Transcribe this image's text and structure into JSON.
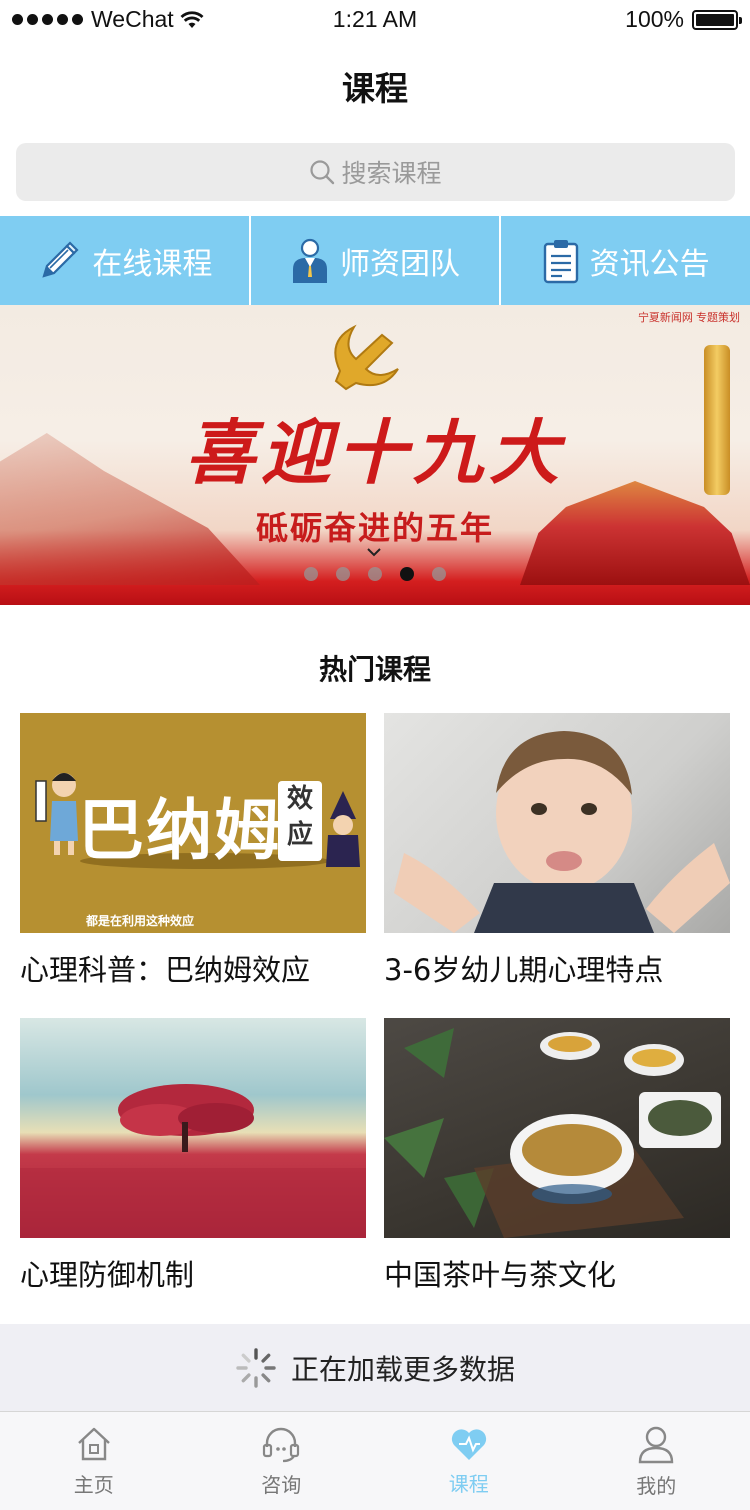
{
  "status_bar": {
    "carrier": "WeChat",
    "time": "1:21 AM",
    "battery": "100%"
  },
  "page_title": "课程",
  "search": {
    "placeholder": "搜索课程"
  },
  "categories": [
    {
      "label": "在线课程",
      "icon": "pencil-icon"
    },
    {
      "label": "师资团队",
      "icon": "teacher-icon"
    },
    {
      "label": "资讯公告",
      "icon": "clipboard-icon"
    }
  ],
  "banner": {
    "headline": "喜迎十九大",
    "subline": "砥砺奋进的五年",
    "corner_tag": "宁夏新闻网 专题策划",
    "slide_count": 5,
    "active_index": 3
  },
  "hot_courses": {
    "title": "热门课程",
    "items": [
      {
        "name": "心理科普：巴纳姆效应",
        "thumb_text": "巴纳姆",
        "thumb_badge": "效应",
        "thumb_caption": "都是在利用这种效应"
      },
      {
        "name": "3-6岁幼儿期心理特点"
      },
      {
        "name": "心理防御机制"
      },
      {
        "name": "中国茶叶与茶文化"
      }
    ]
  },
  "loading_text": "正在加载更多数据",
  "tabbar": [
    {
      "label": "主页",
      "icon": "home-icon",
      "active": false
    },
    {
      "label": "咨询",
      "icon": "headset-icon",
      "active": false
    },
    {
      "label": "课程",
      "icon": "heart-icon",
      "active": true
    },
    {
      "label": "我的",
      "icon": "user-icon",
      "active": false
    }
  ],
  "colors": {
    "accent": "#7fcdf2",
    "search_bg": "#ebebeb",
    "banner_red": "#cd1a1a"
  }
}
